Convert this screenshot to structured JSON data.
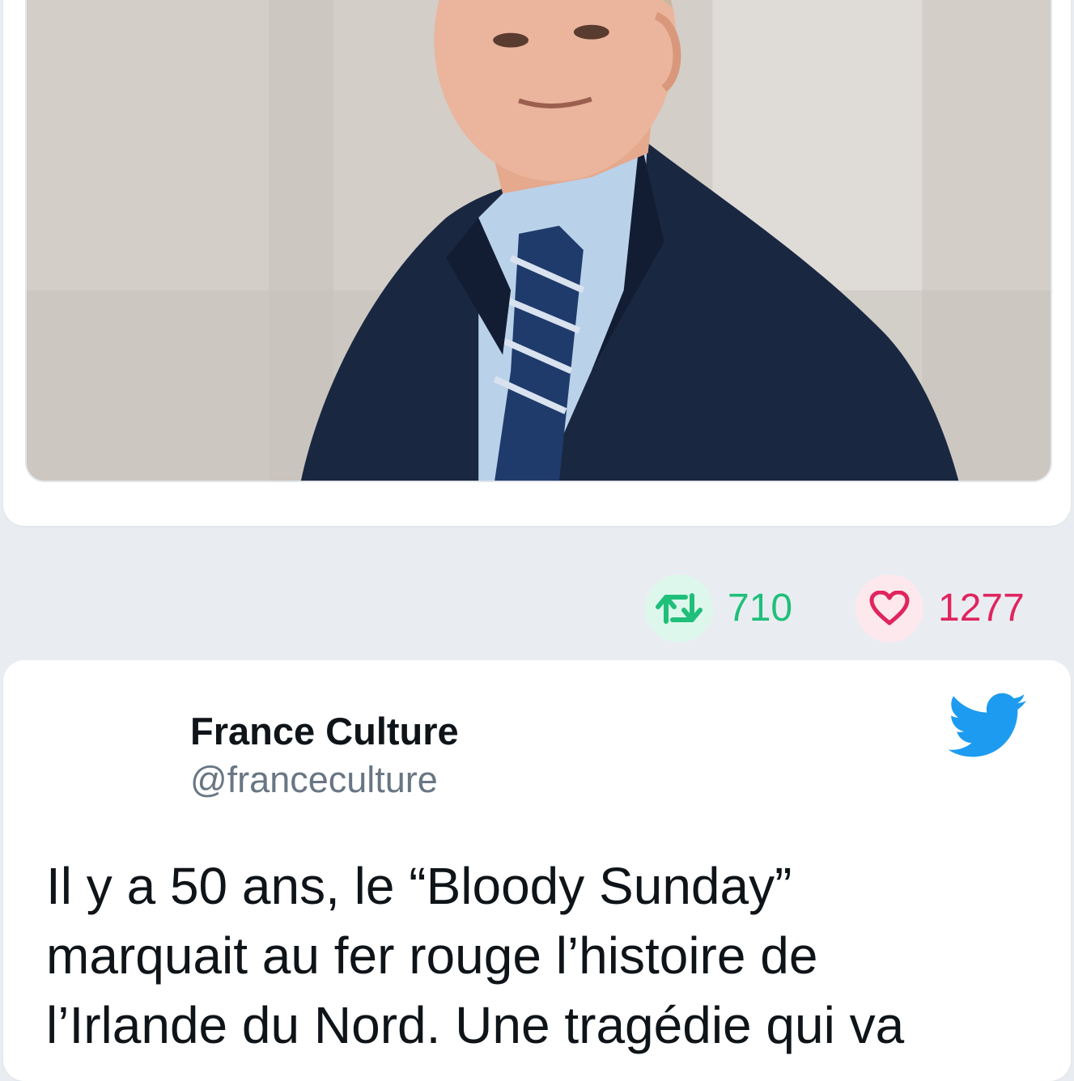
{
  "tweet_media": {
    "alt": "photo of a man in a navy suit and striped tie"
  },
  "engagement": {
    "retweet_count": "710",
    "like_count": "1277",
    "retweet_color": "#1fbf7a",
    "like_color": "#e0245e"
  },
  "second_tweet": {
    "author_name": "France Culture",
    "author_handle": "@franceculture",
    "text": "Il y a 50 ans, le “Bloody Sunday” marquait au fer rouge l’histoire de l’Irlande du Nord. Une tragédie qui va",
    "brand_icon": "twitter-bird-icon",
    "brand_color": "#1d9bf0"
  }
}
